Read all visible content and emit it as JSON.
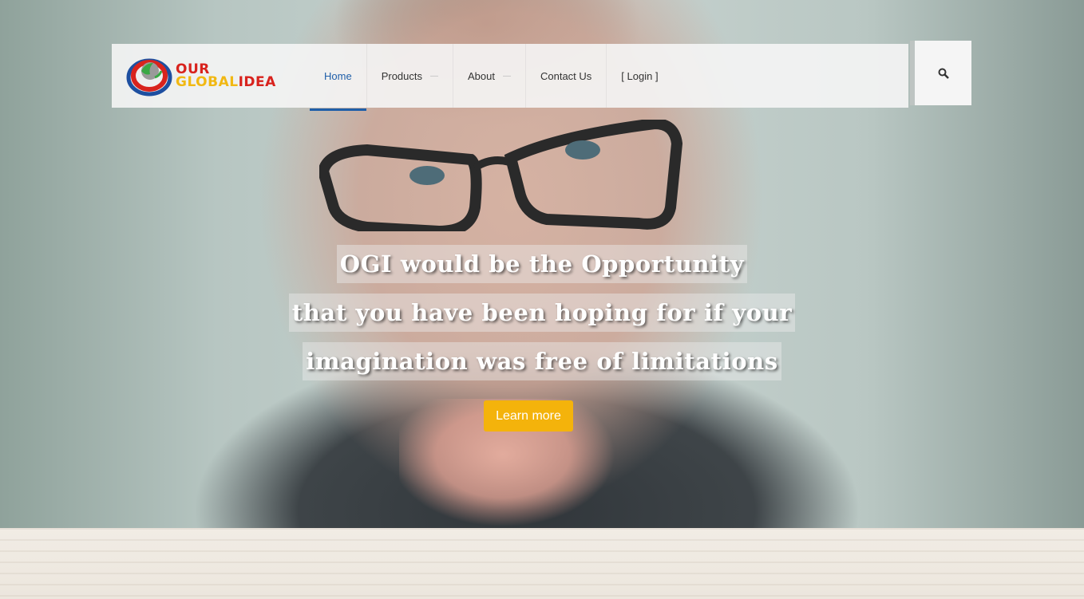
{
  "logo": {
    "line1": "OUR",
    "line2_a": "GLOBAL",
    "line2_b": "IDEA"
  },
  "nav": {
    "items": [
      {
        "label": "Home",
        "active": true
      },
      {
        "label": "Products",
        "has_dropdown": true
      },
      {
        "label": "About",
        "has_dropdown": true
      },
      {
        "label": "Contact Us"
      },
      {
        "label": "[ Login ]"
      }
    ]
  },
  "search": {
    "icon": "search-icon"
  },
  "hero": {
    "headline_lines": [
      "OGI would be the Opportunity",
      "that you have been hoping for if your",
      "imagination was free of limitations"
    ],
    "cta_label": "Learn more"
  },
  "colors": {
    "accent": "#1f5fa9",
    "cta": "#f4b30b",
    "logo_red": "#d8231d",
    "logo_yellow": "#f1b813"
  }
}
